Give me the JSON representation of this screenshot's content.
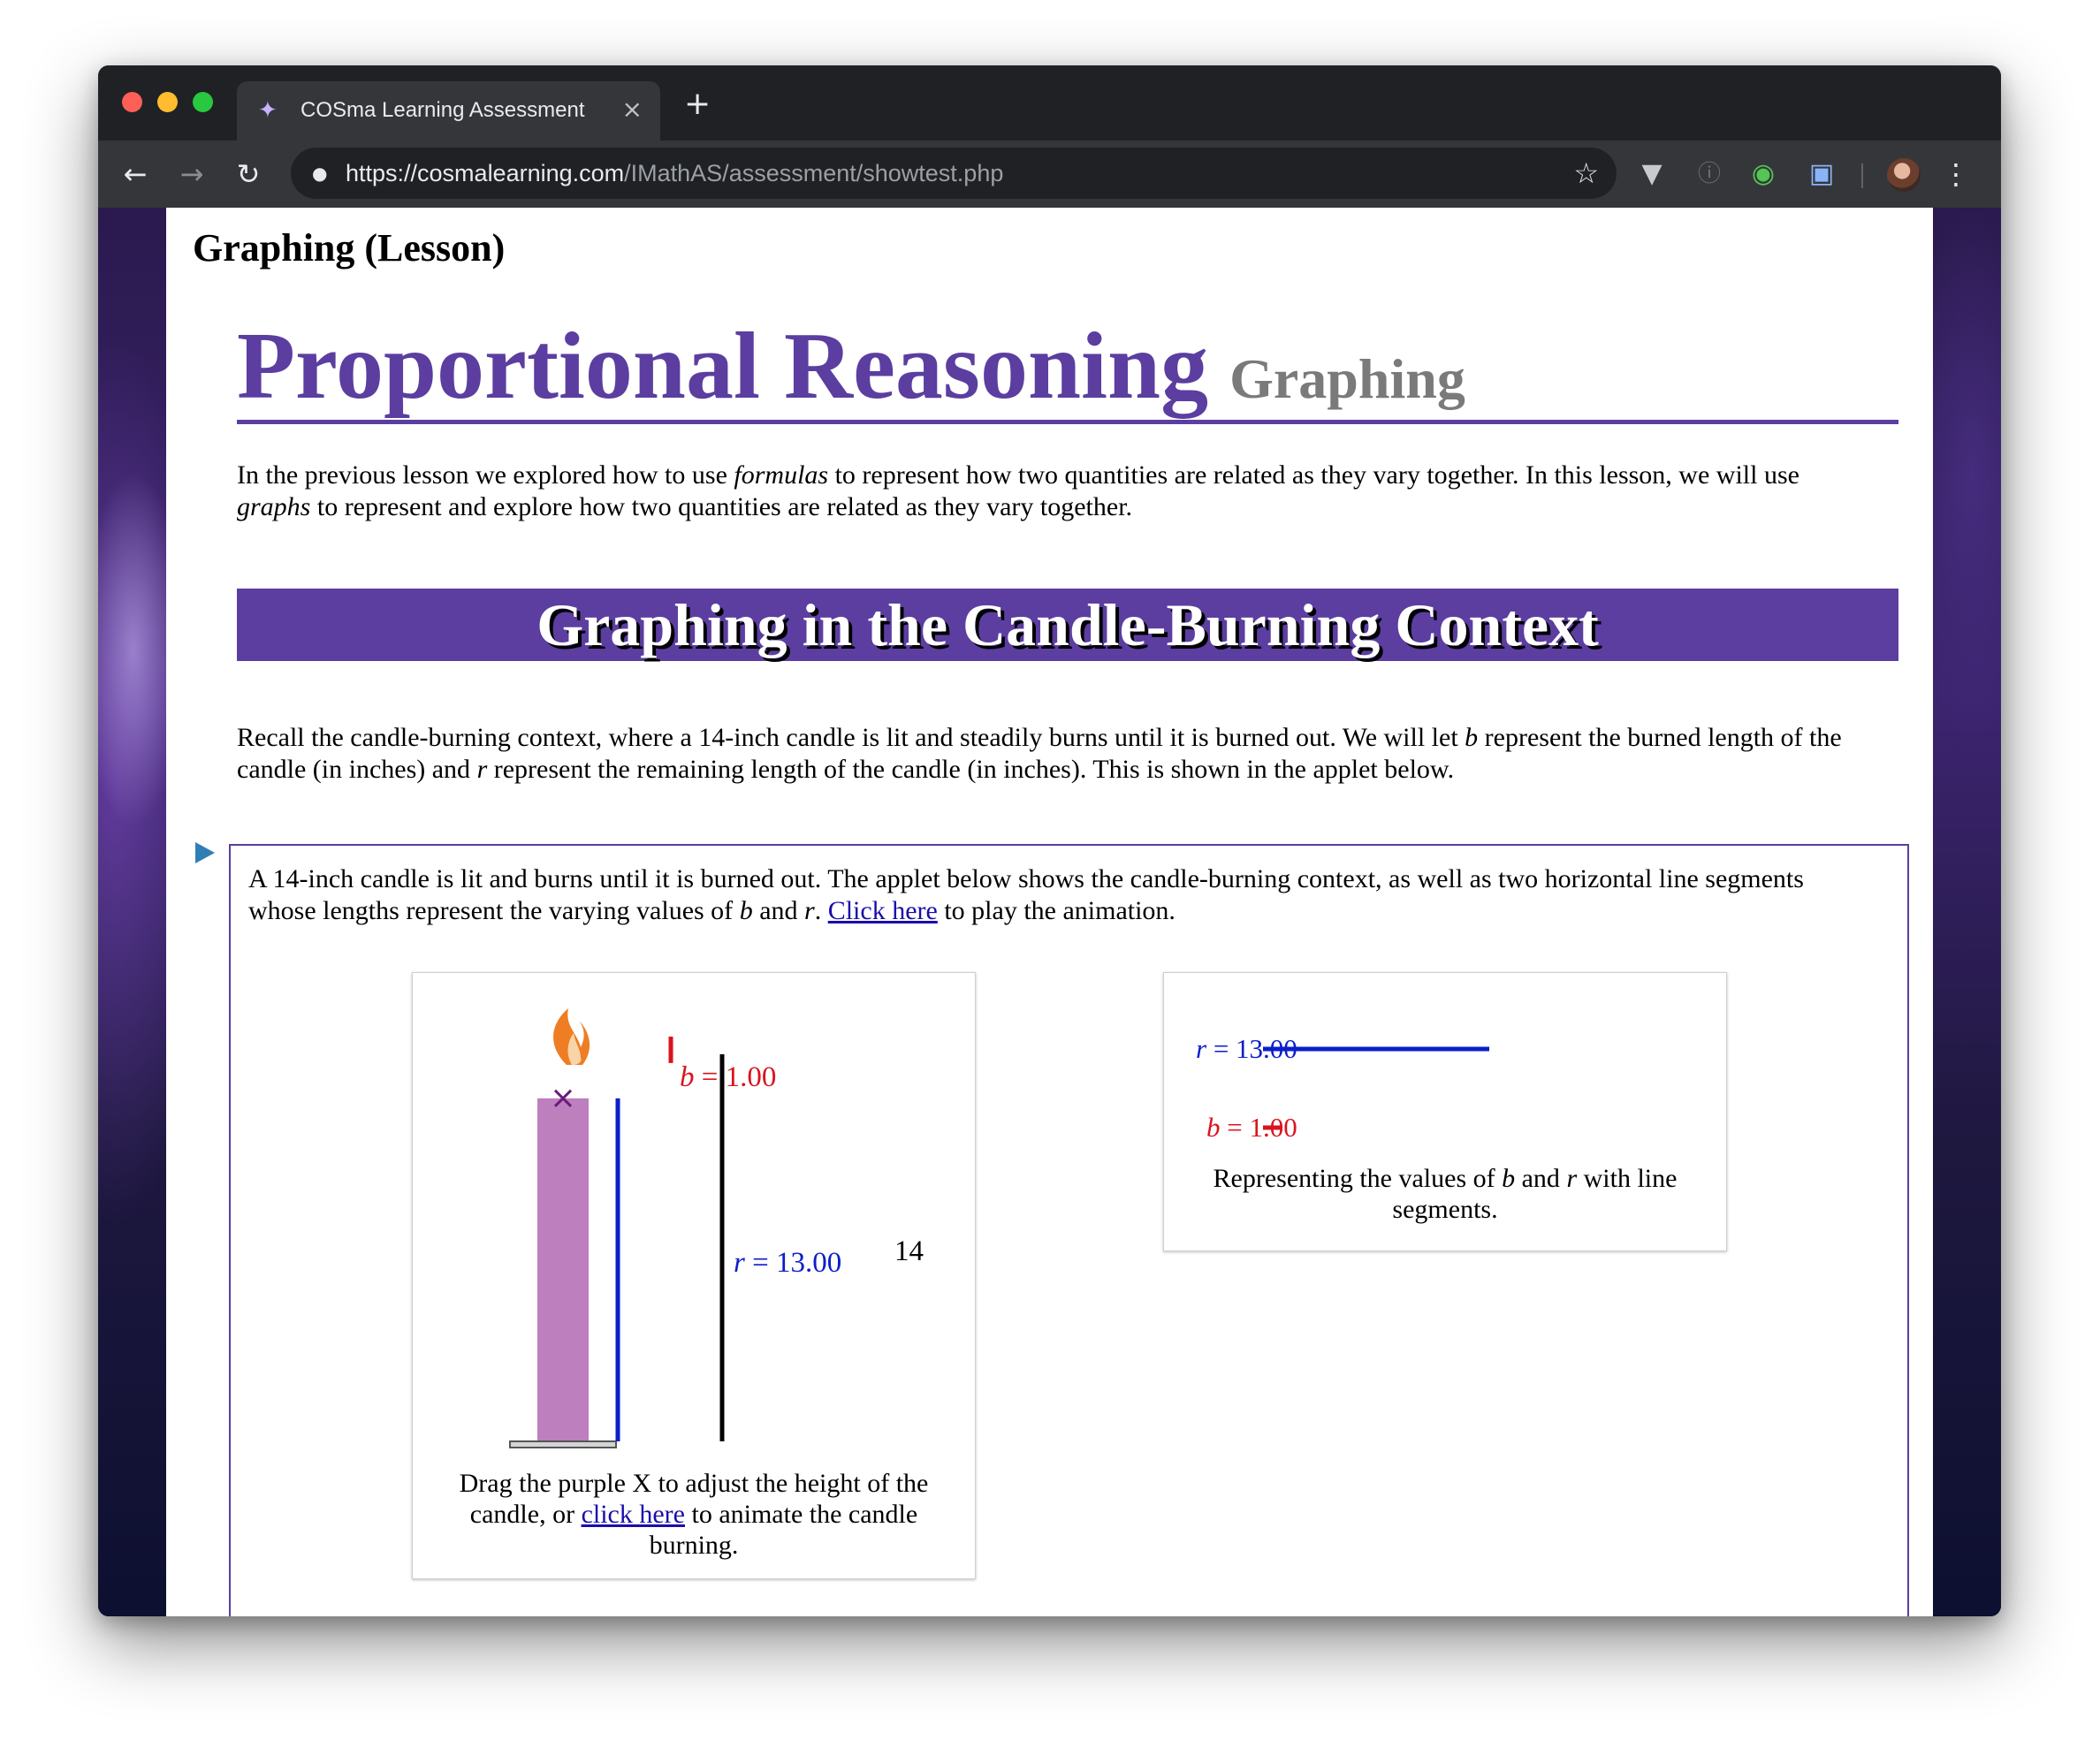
{
  "browser": {
    "tab_title": "COSma Learning Assessment",
    "tab_close": "×",
    "new_tab": "+",
    "url_host": "https://cosmalearning.com",
    "url_path": "/IMathAS/assessment/showtest.php"
  },
  "page": {
    "title": "Graphing (Lesson)",
    "heading_main": "Proportional Reasoning",
    "heading_sub": "Graphing",
    "intro": {
      "p1": "In the previous lesson we explored how to use ",
      "p1_em": "formulas",
      "p2": " to represent how two quantities are related as they vary together. In this lesson, we will use ",
      "p2_em": "graphs",
      "p3": " to represent and explore how two quantities are related as they vary together."
    },
    "section_title": "Graphing in the Candle-Burning Context",
    "recall": {
      "t1": "Recall the candle-burning context, where a 14-inch candle is lit and steadily burns until it is burned out. We will let ",
      "v_b": "b",
      "t2": " represent the burned length of the candle (in inches) and ",
      "v_r": "r",
      "t3": " represent the remaining length of the candle (in inches). This is shown in the applet below."
    }
  },
  "applet": {
    "intro": {
      "t1": "A 14-inch candle is lit and burns until it is burned out. The applet below shows the candle-burning context, as well as two horizontal line segments whose lengths represent the varying values of ",
      "v_b": "b",
      "t2": " and ",
      "v_r": "r",
      "t3": ". ",
      "link": "Click here",
      "t4": " to play the animation."
    },
    "candle": {
      "total_length": 14,
      "b": 1.0,
      "r": 13.0,
      "b_label_var": "b",
      "b_label_val": " = 1.00",
      "r_label_var": "r",
      "r_label_val": " = 13.00",
      "total_label": "14",
      "caption_t1": "Drag the purple X to adjust the height of the candle, or ",
      "caption_link": "click here",
      "caption_t2": " to animate the candle burning.",
      "colors": {
        "candle": "#bd7fbd",
        "r": "#0b1ec9",
        "b": "#d9141e",
        "total": "#000000",
        "x_marker": "#6a1a7a"
      }
    },
    "segments": {
      "r_var": "r",
      "r_val": " = 13.00",
      "b_var": "b",
      "b_val": " = 1.00",
      "caption_t1": "Representing the values of ",
      "v_b": "b",
      "caption_t2": " and ",
      "v_r": "r",
      "caption_t3": " with line segments."
    }
  }
}
